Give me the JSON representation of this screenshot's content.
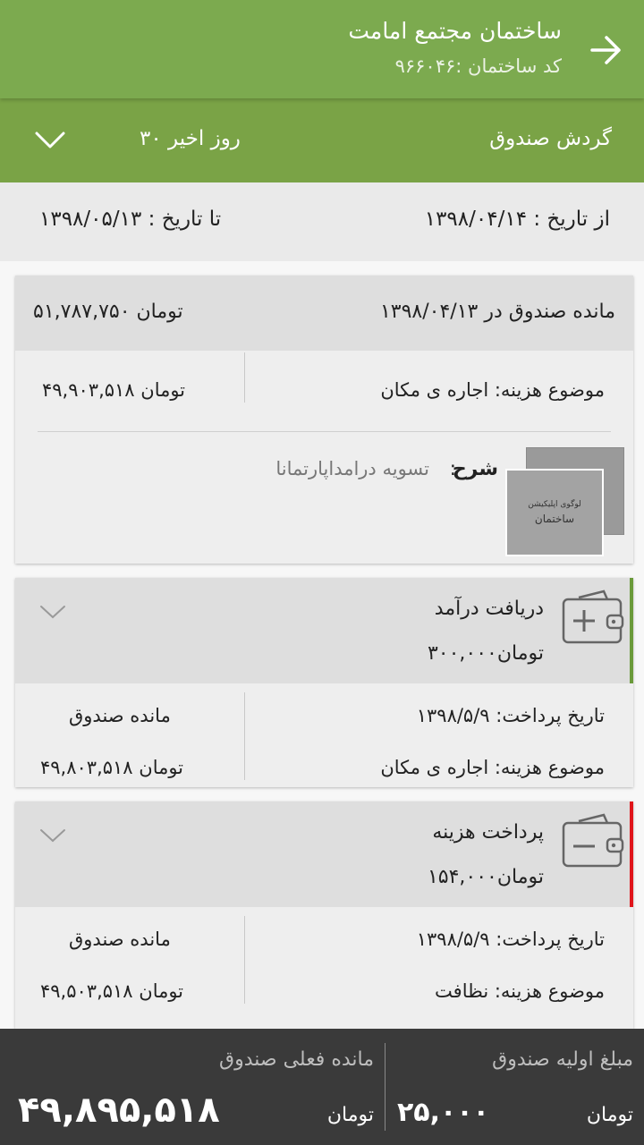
{
  "appbar": {
    "title": "ساختمان مجتمع امامت",
    "subtitle": "کد ساختمان :۹۶۶۰۴۶"
  },
  "filter": {
    "label": "گردش صندوق",
    "period": "۳۰ روز اخیر"
  },
  "dates": {
    "from": "از تاریخ : ۱۳۹۸/۰۴/۱۴",
    "to": "تا تاریخ : ۱۳۹۸/۰۵/۱۳"
  },
  "balance_card": {
    "header": "مانده صندوق در ۱۳۹۸/۰۴/۱۳",
    "header_amount": "۵۱,۷۸۷,۷۵۰ تومان",
    "subject": "موضوع هزینه: اجاره ی مکان",
    "amount": "۴۹,۹۰۳,۵۱۸ تومان",
    "description_label": "شرح",
    "description_sep": ":",
    "description": "تسویه درامداپارتمانا",
    "thumb_line1": "لوگوی اپلیکیشن",
    "thumb_line2": "ساختمان"
  },
  "transactions": [
    {
      "title": "دریافت درآمد",
      "amount": "۳۰۰,۰۰۰تومان",
      "date": "تاریخ پرداخت: ۱۳۹۸/۵/۹",
      "subject": "موضوع هزینه: اجاره ی مکان",
      "balance_label": "مانده صندوق",
      "balance": "۴۹,۸۰۳,۵۱۸ تومان",
      "accent": "#6a9a3a",
      "icon": "wallet-plus-icon"
    },
    {
      "title": "پرداخت هزینه",
      "amount": "۱۵۴,۰۰۰تومان",
      "date": "تاریخ پرداخت: ۱۳۹۸/۵/۹",
      "subject": "موضوع هزینه: نظافت",
      "balance_label": "مانده صندوق",
      "balance": "۴۹,۵۰۳,۵۱۸ تومان",
      "accent": "#e0151b",
      "icon": "wallet-minus-icon"
    }
  ],
  "footer": {
    "current_label": "مانده فعلی صندوق",
    "current_value": "۴۹,۸۹۵,۵۱۸",
    "current_unit": "تومان",
    "initial_label": "مبلغ اولیه صندوق",
    "initial_value": "۲۵,۰۰۰",
    "initial_unit": "تومان"
  },
  "colors": {
    "primary": "#7caa4f",
    "income_accent": "#6a9a3a",
    "expense_accent": "#e0151b",
    "footer_bg": "#3a3a3a"
  }
}
